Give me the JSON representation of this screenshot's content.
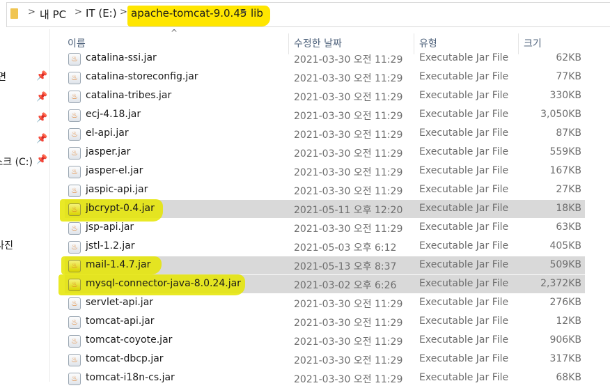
{
  "address_bar": {
    "crumbs": [
      "내 PC",
      "IT (E:)",
      "apache-tomcat-9.0.45",
      "lib"
    ],
    "separator": ">"
  },
  "sidebar": {
    "items": [
      {
        "label": "면",
        "pinned": true
      },
      {
        "label": "",
        "pinned": true
      },
      {
        "label": "",
        "pinned": true
      },
      {
        "label": "",
        "pinned": true
      },
      {
        "label": "스크 (C:)",
        "pinned": true
      },
      {
        "label": "사진",
        "pinned": false
      }
    ],
    "pin_icon": "📌"
  },
  "columns": {
    "name": "이름",
    "date": "수정한 날짜",
    "type": "유형",
    "size": "크기"
  },
  "files": [
    {
      "name": "catalina-ssi.jar",
      "date": "2021-03-30 오전 11:29",
      "type": "Executable Jar File",
      "size": "62KB",
      "selected": false
    },
    {
      "name": "catalina-storeconfig.jar",
      "date": "2021-03-30 오전 11:29",
      "type": "Executable Jar File",
      "size": "77KB",
      "selected": false
    },
    {
      "name": "catalina-tribes.jar",
      "date": "2021-03-30 오전 11:29",
      "type": "Executable Jar File",
      "size": "330KB",
      "selected": false
    },
    {
      "name": "ecj-4.18.jar",
      "date": "2021-03-30 오전 11:29",
      "type": "Executable Jar File",
      "size": "3,050KB",
      "selected": false
    },
    {
      "name": "el-api.jar",
      "date": "2021-03-30 오전 11:29",
      "type": "Executable Jar File",
      "size": "87KB",
      "selected": false
    },
    {
      "name": "jasper.jar",
      "date": "2021-03-30 오전 11:29",
      "type": "Executable Jar File",
      "size": "559KB",
      "selected": false
    },
    {
      "name": "jasper-el.jar",
      "date": "2021-03-30 오전 11:29",
      "type": "Executable Jar File",
      "size": "167KB",
      "selected": false
    },
    {
      "name": "jaspic-api.jar",
      "date": "2021-03-30 오전 11:29",
      "type": "Executable Jar File",
      "size": "27KB",
      "selected": false
    },
    {
      "name": "jbcrypt-0.4.jar",
      "date": "2021-05-11 오후 12:20",
      "type": "Executable Jar File",
      "size": "18KB",
      "selected": true
    },
    {
      "name": "jsp-api.jar",
      "date": "2021-03-30 오전 11:29",
      "type": "Executable Jar File",
      "size": "63KB",
      "selected": false
    },
    {
      "name": "jstl-1.2.jar",
      "date": "2021-05-03 오후 6:12",
      "type": "Executable Jar File",
      "size": "405KB",
      "selected": false
    },
    {
      "name": "mail-1.4.7.jar",
      "date": "2021-05-13 오후 8:37",
      "type": "Executable Jar File",
      "size": "509KB",
      "selected": true
    },
    {
      "name": "mysql-connector-java-8.0.24.jar",
      "date": "2021-03-02 오후 6:26",
      "type": "Executable Jar File",
      "size": "2,372KB",
      "selected": true
    },
    {
      "name": "servlet-api.jar",
      "date": "2021-03-30 오전 11:29",
      "type": "Executable Jar File",
      "size": "276KB",
      "selected": false
    },
    {
      "name": "tomcat-api.jar",
      "date": "2021-03-30 오전 11:29",
      "type": "Executable Jar File",
      "size": "12KB",
      "selected": false
    },
    {
      "name": "tomcat-coyote.jar",
      "date": "2021-03-30 오전 11:29",
      "type": "Executable Jar File",
      "size": "906KB",
      "selected": false
    },
    {
      "name": "tomcat-dbcp.jar",
      "date": "2021-03-30 오전 11:29",
      "type": "Executable Jar File",
      "size": "317KB",
      "selected": false
    },
    {
      "name": "tomcat-i18n-cs.jar",
      "date": "2021-03-30 오전 11:29",
      "type": "Executable Jar File",
      "size": "68KB",
      "selected": false
    }
  ],
  "colors": {
    "highlight": "#e5e500",
    "selected_row": "#d9d9d9"
  }
}
